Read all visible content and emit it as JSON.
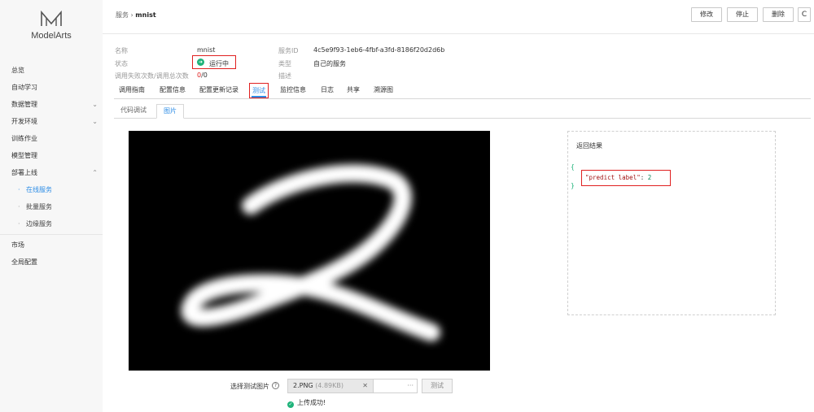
{
  "app": {
    "name": "ModelArts"
  },
  "nav": {
    "items": [
      {
        "label": "总览"
      },
      {
        "label": "自动学习"
      },
      {
        "label": "数据管理"
      },
      {
        "label": "开发环境"
      },
      {
        "label": "训练作业"
      },
      {
        "label": "模型管理"
      },
      {
        "label": "部署上线"
      }
    ],
    "sub": [
      {
        "label": "在线服务"
      },
      {
        "label": "批量服务"
      },
      {
        "label": "边缘服务"
      }
    ],
    "bottom": [
      {
        "label": "市场"
      },
      {
        "label": "全局配置"
      }
    ]
  },
  "header": {
    "crumb_parent": "服务",
    "crumb_sep": "›",
    "crumb_current": "mnist",
    "btn_modify": "修改",
    "btn_stop": "停止",
    "btn_delete": "删除",
    "refresh_icon": "C"
  },
  "info": {
    "name_label": "名称",
    "name_value": "mnist",
    "status_label": "状态",
    "status_value": "运行中",
    "fail_label": "调用失败次数/调用总次数",
    "fail_count": "0",
    "total_count": "/0",
    "id_label": "服务ID",
    "id_value": "4c5e9f93-1eb6-4fbf-a3fd-8186f20d2d6b",
    "type_label": "类型",
    "type_value": "自己的服务",
    "desc_label": "描述"
  },
  "tabs": [
    "调用指南",
    "配置信息",
    "配置更新记录",
    "测试",
    "监控信息",
    "日志",
    "共享",
    "溯源图"
  ],
  "subtabs": [
    "代码调试",
    "图片"
  ],
  "result": {
    "title": "返回结果",
    "open_brace": "{",
    "close_brace": "}",
    "key": "\"predict label\"",
    "colon": ": ",
    "value": "2"
  },
  "upload": {
    "label": "选择测试图片",
    "file_name": "2.PNG",
    "file_size": "(4.89KB)",
    "clear": "✕",
    "browse": "···",
    "test_btn": "测试",
    "success_text": "上传成功!"
  },
  "colors": {
    "accent": "#2e8de6",
    "success": "#1fb37a",
    "highlight": "#e02020"
  }
}
